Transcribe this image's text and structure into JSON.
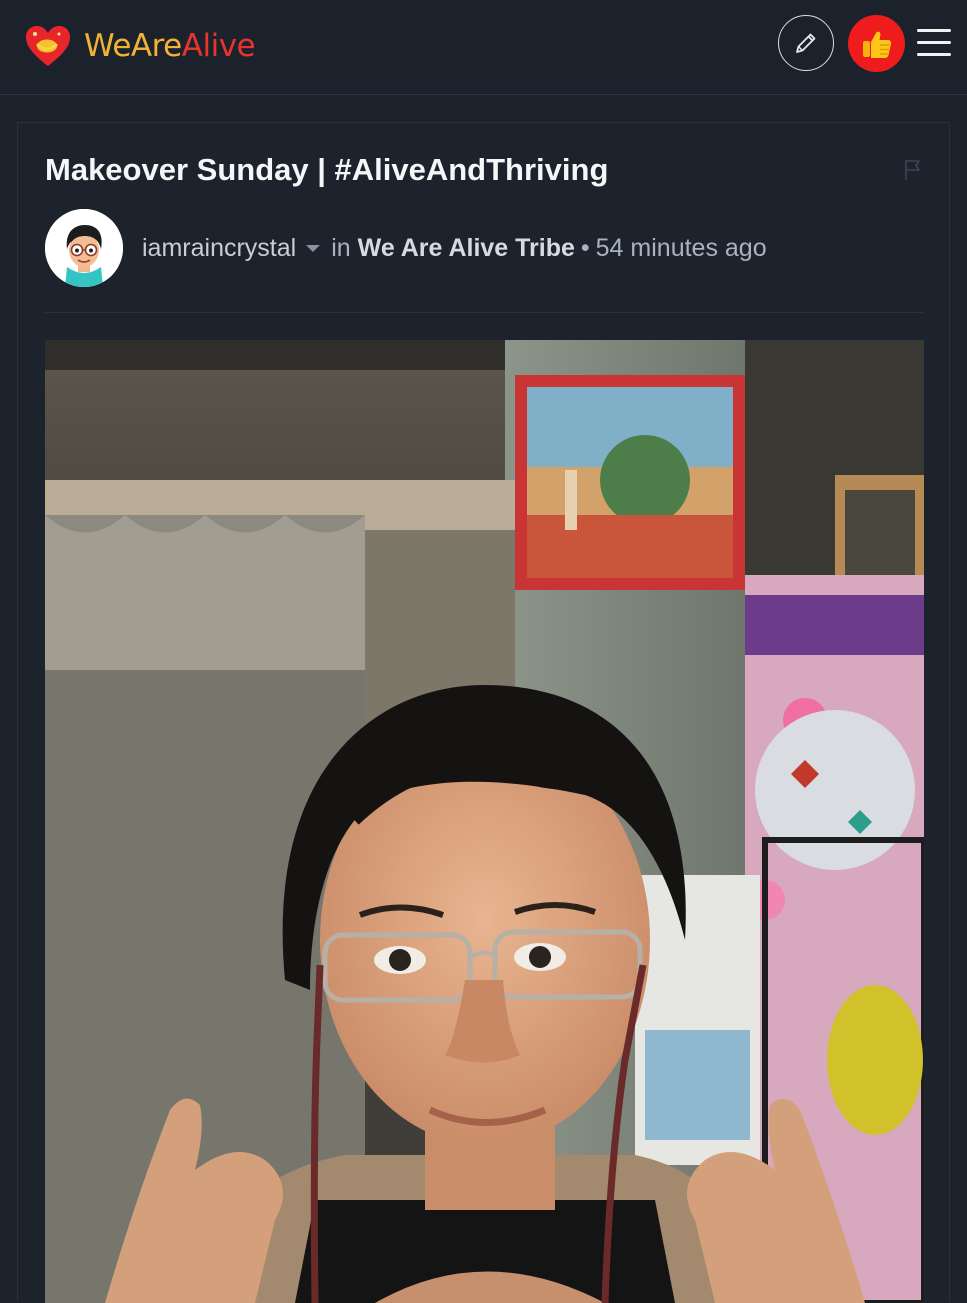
{
  "app": {
    "brand_part1": "WeAre",
    "brand_part2": "Alive",
    "brand_colors": {
      "we_are": "#f2b233",
      "alive": "#e8342c",
      "heart": "#e8262a"
    }
  },
  "header": {
    "icons": [
      "heart-logo-icon",
      "pencil-icon",
      "thumbs-up-icon",
      "hamburger-menu-icon"
    ],
    "vote_button_color": "#ee1c1c"
  },
  "post": {
    "title": "Makeover Sunday | #AliveAndThriving",
    "author": "iamraincrystal",
    "in_label": "in",
    "community": "We Are Alive Tribe",
    "separator": "•",
    "time_ago": "54 minutes ago",
    "image_icon": "selfie-photo"
  }
}
